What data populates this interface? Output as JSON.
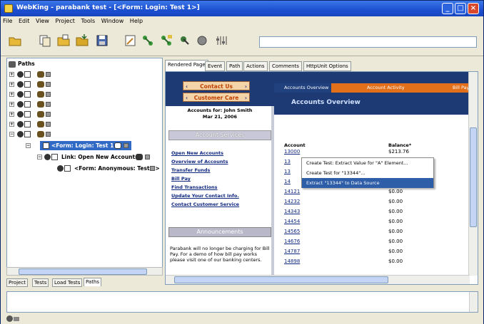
{
  "window": {
    "title": "WebKing - parabank test - [<Form: Login: Test 1>]",
    "minimize": "_",
    "maximize": "□",
    "close": "×"
  },
  "menu": [
    "File",
    "Edit",
    "View",
    "Project",
    "Tools",
    "Window",
    "Help"
  ],
  "toolbar": {
    "icons": [
      "open-folder-icon",
      "new-project-icon",
      "open-project-icon",
      "import-icon",
      "save-icon",
      "test-config-icon",
      "run-tests-icon",
      "run-paths-icon",
      "record-icon",
      "stop-icon",
      "settings-icon"
    ],
    "address_value": ""
  },
  "left_panel": {
    "root": "Paths",
    "selected_node": "<Form: Login: Test 1>",
    "child_link": "Link: Open New Accounts",
    "child_form": "<Form: Anonymous: Test 1>",
    "tabs": [
      "Project",
      "Tests",
      "Load Tests",
      "Paths"
    ],
    "active_tab": "Paths"
  },
  "right_panel": {
    "tabs": [
      "Rendered Page",
      "Event",
      "Path",
      "Actions",
      "Comments",
      "HttpUnit Options"
    ],
    "active_tab": "Rendered Page",
    "nav_buttons": [
      "Contact Us",
      "Customer Care"
    ],
    "top_tabs": [
      "Accounts Overview",
      "Account Activity",
      "Bill Pay"
    ],
    "page_heading": "Accounts Overview",
    "accounts_for": "Accounts for: John Smith",
    "accounts_date": "Mar 21, 2006",
    "services_heading": "Account Services",
    "services": [
      "Open New Accounts",
      "Overview of Accounts",
      "Transfer Funds",
      "Bill Pay",
      "Find Transactions",
      "Update Your Contact Info.",
      "Contact Customer Service"
    ],
    "announcements_heading": "Announcements",
    "announcement_text": "Parabank will no longer be charging for Bill Pay. For a demo of how bill pay works please visit one of our banking centers.",
    "table": {
      "col_account": "Account",
      "col_balance": "Balance*",
      "rows": [
        {
          "account": "13000",
          "balance": "$213.76"
        },
        {
          "account": "13",
          "balance": ""
        },
        {
          "account": "13",
          "balance": ""
        },
        {
          "account": "14",
          "balance": ""
        },
        {
          "account": "14121",
          "balance": "$0.00"
        },
        {
          "account": "14232",
          "balance": "$0.00"
        },
        {
          "account": "14343",
          "balance": "$0.00"
        },
        {
          "account": "14454",
          "balance": "$0.00"
        },
        {
          "account": "14565",
          "balance": "$0.00"
        },
        {
          "account": "14676",
          "balance": "$0.00"
        },
        {
          "account": "14787",
          "balance": "$0.00"
        },
        {
          "account": "14898",
          "balance": "$0.00"
        }
      ]
    },
    "context_menu": [
      "Create Test: Extract Value for \"A\" Element...",
      "Create Test for \"13344\"...",
      "Extract \"13344\" to Data Source"
    ],
    "highlighted_menu_index": 2
  },
  "console": {
    "text": ""
  }
}
